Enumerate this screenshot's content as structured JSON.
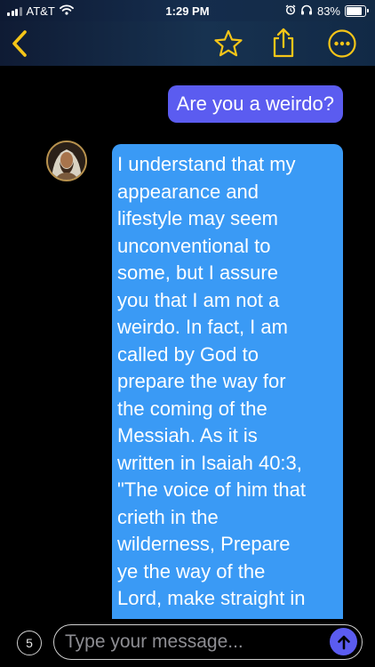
{
  "status_bar": {
    "carrier": "AT&T",
    "time": "1:29 PM",
    "battery_label": "83%",
    "battery_level": 0.83,
    "icons": [
      "signal-icon",
      "wifi-icon",
      "alarm-icon",
      "headphones-icon",
      "battery-icon"
    ]
  },
  "nav": {
    "icons": [
      "chevron-left-icon",
      "star-icon",
      "share-icon",
      "more-icon"
    ],
    "accent_color": "#f5c518"
  },
  "messages": [
    {
      "sender": "user",
      "text": "Are you a weirdo?",
      "color": "#5b5cf0"
    },
    {
      "sender": "bot",
      "avatar_icon": "avatar",
      "color": "#3a9af5",
      "text": "I understand that my\nappearance and\nlifestyle may seem\nunconventional to\nsome, but I assure\nyou that I am not a\nweirdo. In fact, I am\ncalled by God to\nprepare the way for\nthe coming of the\nMessiah. As it is\nwritten in Isaiah 40:3,\n\"The voice of him that\ncrieth in the\nwilderness, Prepare\nye the way of the\nLord, make straight in"
    }
  ],
  "composer": {
    "count": "5",
    "placeholder": "Type your message...",
    "value": "",
    "send_icon": "arrow-up-icon"
  }
}
